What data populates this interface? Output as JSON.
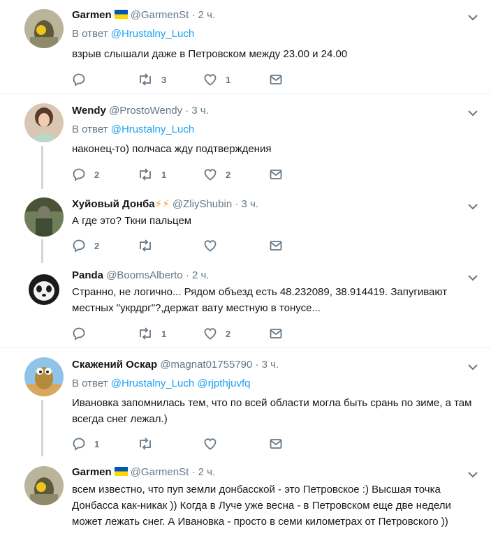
{
  "colors": {
    "link": "#1da1f2",
    "secondary": "#657786",
    "text": "#14171a",
    "separator": "#e6ecf0"
  },
  "tweets": [
    {
      "name": "Garmen",
      "handle": "@GarmenSt",
      "dot": "·",
      "time": "2 ч.",
      "reply_prefix": "В ответ",
      "reply_to": "@Hrustalny_Luch",
      "text": "взрыв слышали даже в Петровском между 23.00 и 24.00",
      "replies": "",
      "retweets": "3",
      "likes": "1"
    },
    {
      "name": "Wendy",
      "handle": "@ProstoWendy",
      "dot": "·",
      "time": "3 ч.",
      "reply_prefix": "В ответ",
      "reply_to": "@Hrustalny_Luch",
      "text": "наконец-то) полчаса жду подтверждения",
      "replies": "2",
      "retweets": "1",
      "likes": "2"
    },
    {
      "name": "Хуйовый Донба",
      "bolts": "⚡⚡",
      "handle": "@ZliyShubin",
      "dot": "·",
      "time": "3 ч.",
      "text": "А где это? Ткни пальцем",
      "replies": "2",
      "retweets": "",
      "likes": ""
    },
    {
      "name": "Panda",
      "handle": "@BoomsAlberto",
      "dot": "·",
      "time": "2 ч.",
      "text": "Странно, не логично... Рядом объезд есть 48.232089, 38.914419. Запугивают местных \"укрдрг\"?,держат вату местную в тонусе...",
      "replies": "",
      "retweets": "1",
      "likes": "2"
    },
    {
      "name": "Скажений Оскар",
      "handle": "@magnat01755790",
      "dot": "·",
      "time": "3 ч.",
      "reply_prefix": "В ответ",
      "reply_to": "@Hrustalny_Luch",
      "reply_to2": "@rjpthjuvfq",
      "text": "Ивановка запомнилась тем, что по всей области могла быть срань по зиме, а там всегда снег лежал.)",
      "replies": "1",
      "retweets": "",
      "likes": ""
    },
    {
      "name": "Garmen",
      "handle": "@GarmenSt",
      "dot": "·",
      "time": "2 ч.",
      "text": "всем известно, что пуп земли донбасской - это Петровское :) Высшая точка Донбасса как-никак )) Когда в Луче уже весна - в Петровском еще две недели может лежать снег. А Ивановка - просто в семи километрах от Петровского ))"
    }
  ]
}
